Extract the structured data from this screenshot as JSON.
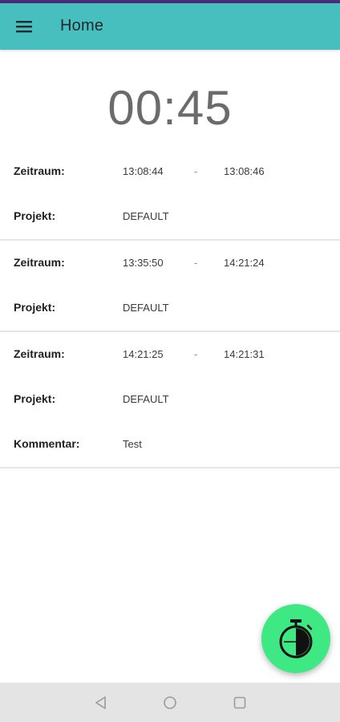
{
  "app": {
    "title": "Home",
    "colors": {
      "app_bar": "#47bfbf",
      "status_strip": "#4a2a7a",
      "fab": "#3ee882",
      "nav_bar": "#e4e4e4"
    }
  },
  "toolbar": {
    "menu_icon": "hamburger-menu-icon"
  },
  "timer": {
    "display": "00:45"
  },
  "entries": [
    {
      "zeitraum_label": "Zeitraum:",
      "start": "13:08:44",
      "separator": "-",
      "end": "13:08:46",
      "projekt_label": "Projekt:",
      "projekt": "DEFAULT"
    },
    {
      "zeitraum_label": "Zeitraum:",
      "start": "13:35:50",
      "separator": "-",
      "end": "14:21:24",
      "projekt_label": "Projekt:",
      "projekt": "DEFAULT"
    },
    {
      "zeitraum_label": "Zeitraum:",
      "start": "14:21:25",
      "separator": "-",
      "end": "14:21:31",
      "projekt_label": "Projekt:",
      "projekt": "DEFAULT",
      "kommentar_label": "Kommentar:",
      "kommentar": "Test"
    }
  ],
  "fab": {
    "icon": "stopwatch-icon"
  },
  "system_nav": {
    "back_icon": "back-triangle-icon",
    "home_icon": "home-circle-icon",
    "recents_icon": "recents-square-icon"
  }
}
